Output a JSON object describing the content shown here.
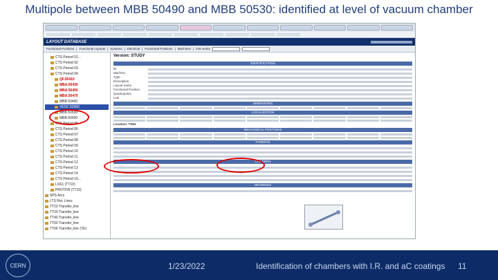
{
  "slide": {
    "title": "Multipole between MBB 50490 and MBB 50530: identified at level of vacuum chamber",
    "footer_date": "1/23/2022",
    "footer_caption": "Identification of chambers with I.R. and aC coatings",
    "page_number": "11",
    "logo_text": "CERN",
    "colors": {
      "title": "#1f3d7a",
      "footer_bg": "#0d2c67",
      "highlight": "#e00000"
    }
  },
  "app": {
    "banner": "LAYOUT DATABASE",
    "menu": [
      "Functional Positions",
      "Functional Layouts",
      "Systems",
      "Electrical",
      "Functional Positions",
      "Machines",
      "GIS works"
    ],
    "version": "Version: STUDY",
    "sections": [
      "IDENTIFICATION",
      "DIMENSIONS",
      "LOCALIZATION",
      "MECHANICAL POSITIONS",
      "PARENTS",
      "CHILDREN",
      "DRAWINGS"
    ],
    "fields": [
      "ID",
      "Machine",
      "Type",
      "Description",
      "Layout name",
      "Functional Position",
      "Quadrupoles",
      "Link"
    ],
    "location": "Location: TS84"
  },
  "tree": {
    "items": [
      {
        "label": "CTS Period 01...",
        "level": 1
      },
      {
        "label": "CTS Period 02",
        "level": 1
      },
      {
        "label": "CTS Period 03",
        "level": 1
      },
      {
        "label": "CTS Period 04",
        "level": 1
      },
      {
        "label": "QF.50410",
        "level": 2,
        "style": "red"
      },
      {
        "label": "MBA.50430",
        "level": 2,
        "style": "red"
      },
      {
        "label": "MBA.50450",
        "level": 2,
        "style": "red"
      },
      {
        "label": "MBA.50470",
        "level": 2,
        "style": "red"
      },
      {
        "label": "MBB.50490",
        "level": 2
      },
      {
        "label": "VESC.50560",
        "level": 2,
        "style": "hl"
      },
      {
        "label": "MBB.50530",
        "level": 2
      },
      {
        "label": "MBB.50550",
        "level": 2
      },
      {
        "label": "CTS Period 05",
        "level": 1
      },
      {
        "label": "CTS Period 06",
        "level": 1
      },
      {
        "label": "CTS Period 07",
        "level": 1
      },
      {
        "label": "CTS Period 08",
        "level": 1
      },
      {
        "label": "CTS Period 09",
        "level": 1
      },
      {
        "label": "CTS Period 10",
        "level": 1
      },
      {
        "label": "CTS Period 11",
        "level": 1
      },
      {
        "label": "CTS Period 12",
        "level": 1
      },
      {
        "label": "CTS Period 13",
        "level": 1
      },
      {
        "label": "CTS Period 14",
        "level": 1
      },
      {
        "label": "CTS Period 15...",
        "level": 1
      },
      {
        "label": "LSS1 (TT10)",
        "level": 1
      },
      {
        "label": "PROTON (TT10)",
        "level": 1
      },
      {
        "label": "SPS Arcs",
        "level": 0
      },
      {
        "label": "LTS Rot. Lines",
        "level": 0
      },
      {
        "label": "TT10 Transfer_line",
        "level": 0
      },
      {
        "label": "TT20 Transfer_line",
        "level": 0
      },
      {
        "label": "TT40 Transfer_line",
        "level": 0
      },
      {
        "label": "TT60 Transfer_line",
        "level": 0
      },
      {
        "label": "TT66 Transfer_line (TE)",
        "level": 0
      }
    ]
  }
}
